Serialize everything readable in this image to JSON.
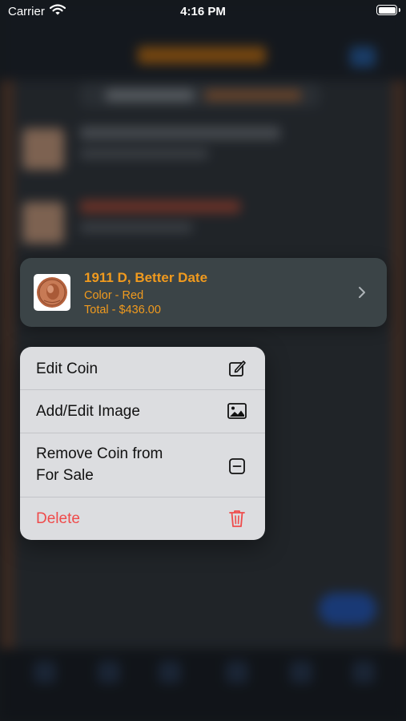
{
  "status_bar": {
    "carrier": "Carrier",
    "time": "4:16 PM"
  },
  "coin_card": {
    "title": "1911 D, Better Date",
    "color_line": "Color - Red",
    "total_line": "Total - $436.00",
    "accent_color": "#f09a1e",
    "image_icon": "penny-coin-icon"
  },
  "context_menu": {
    "items": [
      {
        "label": "Edit Coin",
        "icon": "edit-square-pencil-icon"
      },
      {
        "label": "Add/Edit Image",
        "icon": "photo-icon"
      },
      {
        "label_line1": "Remove Coin from",
        "label_line2": "For Sale",
        "icon": "minus-square-icon"
      },
      {
        "label": "Delete",
        "icon": "trash-icon",
        "color": "#ef4b4b"
      }
    ]
  }
}
